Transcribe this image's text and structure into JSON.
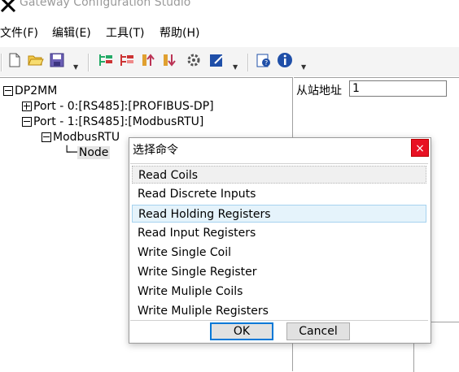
{
  "window": {
    "title": "Gateway Configuration Studio"
  },
  "menu": [
    {
      "label": "文件(F)"
    },
    {
      "label": "编辑(E)"
    },
    {
      "label": "工具(T)"
    },
    {
      "label": "帮助(H)"
    }
  ],
  "toolbar": {
    "icons": [
      "new-file-icon",
      "open-folder-icon",
      "save-icon",
      "add-node-icon",
      "delete-node-icon",
      "move-up-icon",
      "move-down-icon",
      "settings-icon",
      "edit-icon",
      "help-query-icon",
      "info-icon"
    ]
  },
  "tree": {
    "root": "DP2MM",
    "port0": "Port - 0:[RS485]:[PROFIBUS-DP]",
    "port1": "Port - 1:[RS485]:[ModbusRTU]",
    "modbus": "ModbusRTU",
    "node": "Node"
  },
  "properties": {
    "slave_address_label": "从站地址",
    "slave_address_value": "1"
  },
  "dialog": {
    "title": "选择命令",
    "close": "×",
    "commands": [
      "Read Coils",
      "Read Discrete Inputs",
      "Read Holding Registers",
      "Read Input Registers",
      "Write Single Coil",
      "Write Single Register",
      "Write Muliple Coils",
      "Write Muliple Registers"
    ],
    "ok_label": "OK",
    "cancel_label": "Cancel"
  },
  "colors": {
    "close_button": "#e81123",
    "hover_item": "#e5f3fb",
    "default_button_border": "#0078d7"
  }
}
